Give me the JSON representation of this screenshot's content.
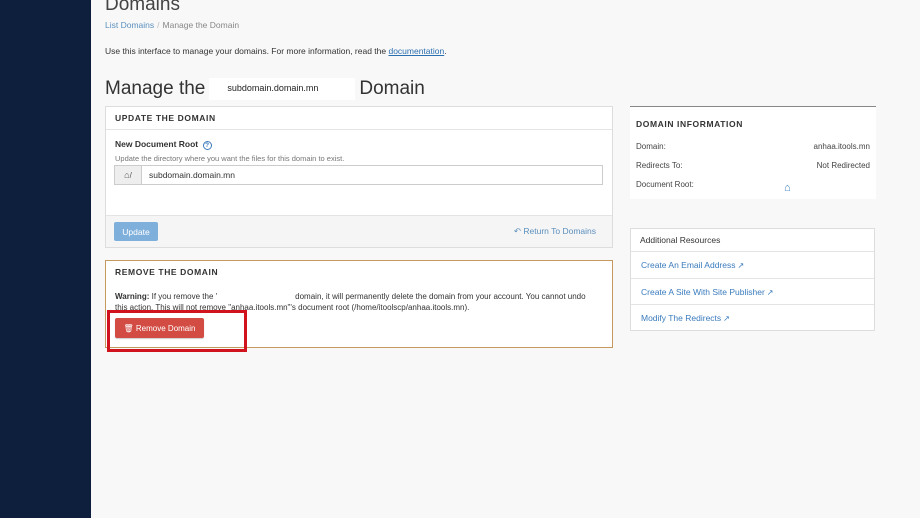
{
  "header": {
    "title": "Domains",
    "breadcrumb": [
      "List Domains",
      "Manage the Domain"
    ],
    "intro_text": "Use this interface to manage your domains. For more information, read the ",
    "intro_link": "documentation",
    "intro_end": "."
  },
  "manage": {
    "prefix": "Manage the",
    "domain": "subdomain.domain.mn",
    "suffix": "Domain"
  },
  "update": {
    "title": "UPDATE THE DOMAIN",
    "field_label": "New Document Root",
    "field_help": "Update the directory where you want the files for this domain to exist.",
    "addon_text": "/",
    "field_value": "subdomain.domain.mn",
    "update_label": "Update",
    "return_label": "Return To Domains"
  },
  "remove": {
    "title": "REMOVE THE DOMAIN",
    "warning_label": "Warning:",
    "warning_text_1": " If you remove the '",
    "warning_text_2": "domain, it will permanently delete the domain from your account. You cannot undo this action. This will not remove \"anhaa.itools.mn\"'s document root (/home/itoolscp/anhaa.itools.mn).",
    "button_label": "Remove Domain"
  },
  "info": {
    "title": "DOMAIN INFORMATION",
    "rows": [
      {
        "label": "Domain:",
        "value": "anhaa.itools.mn"
      },
      {
        "label": "Redirects To:",
        "value": "Not Redirected"
      },
      {
        "label": "Document Root:",
        "value": ""
      }
    ]
  },
  "resources": {
    "title": "Additional Resources",
    "items": [
      "Create An Email Address",
      "Create A Site With Site Publisher",
      "Modify The Redirects"
    ]
  },
  "colors": {
    "sidebar": "#0e1f3d",
    "link": "#3a7bbd",
    "danger": "#d24c43",
    "update_button": "#7fb0dc",
    "highlight": "#d0131c"
  }
}
